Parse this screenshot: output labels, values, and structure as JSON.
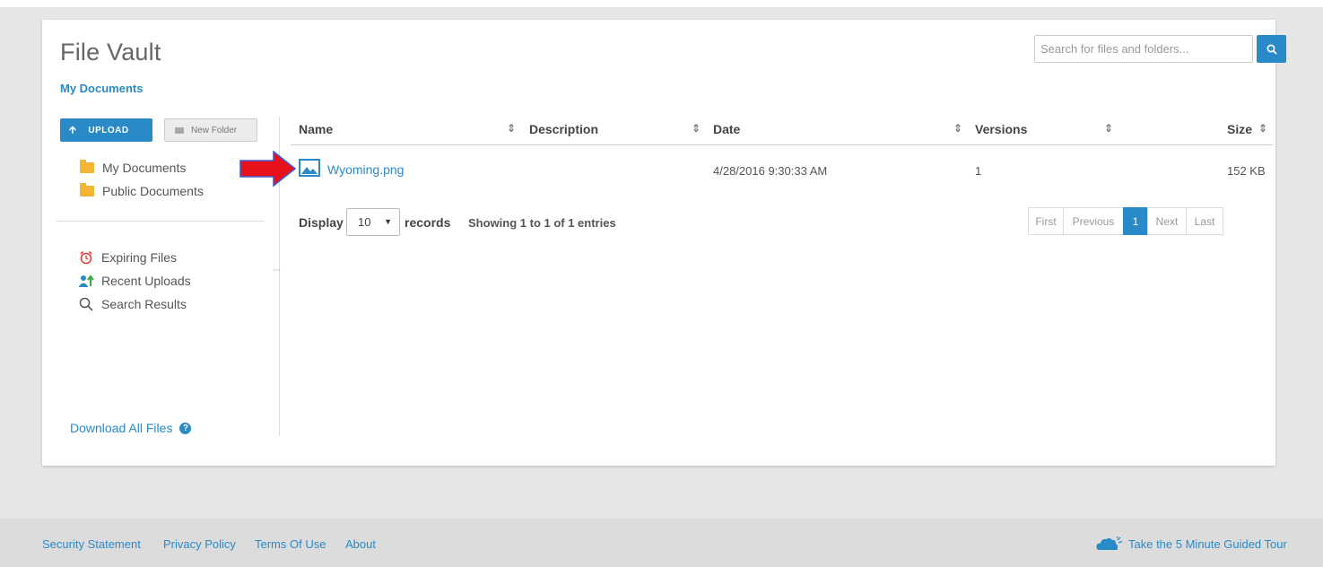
{
  "app": {
    "title": "File Vault",
    "breadcrumb": "My Documents"
  },
  "search": {
    "placeholder": "Search for files and folders..."
  },
  "toolbar": {
    "upload_label": "UPLOAD",
    "new_folder_label": "New Folder"
  },
  "sidebar": {
    "folders": [
      {
        "label": "My Documents",
        "icon": "folder-icon"
      },
      {
        "label": "Public Documents",
        "icon": "folder-icon"
      }
    ],
    "quick_links": [
      {
        "label": "Expiring Files",
        "icon": "alarm-clock-icon"
      },
      {
        "label": "Recent Uploads",
        "icon": "recent-uploads-icon"
      },
      {
        "label": "Search Results",
        "icon": "search-icon"
      }
    ],
    "download_all": "Download All Files"
  },
  "table": {
    "columns": [
      "Name",
      "Description",
      "Date",
      "Versions",
      "Size"
    ],
    "rows": [
      {
        "name": "Wyoming.png",
        "description": "",
        "date": "4/28/2016 9:30:33 AM",
        "versions": "1",
        "size": "152 KB",
        "icon": "image-file-icon"
      }
    ]
  },
  "paging": {
    "display_label": "Display",
    "page_size": "10",
    "records_label": "records",
    "showing": "Showing 1 to 1 of 1 entries",
    "buttons": [
      "First",
      "Previous",
      "1",
      "Next",
      "Last"
    ],
    "current_page": "1"
  },
  "footer": {
    "links": [
      "Security Statement",
      "Privacy Policy",
      "Terms Of Use",
      "About"
    ],
    "tour": "Take the 5 Minute Guided Tour"
  },
  "colors": {
    "accent": "#2a8ac7",
    "folder": "#f2b632",
    "annotation_arrow": "#e8101a"
  }
}
